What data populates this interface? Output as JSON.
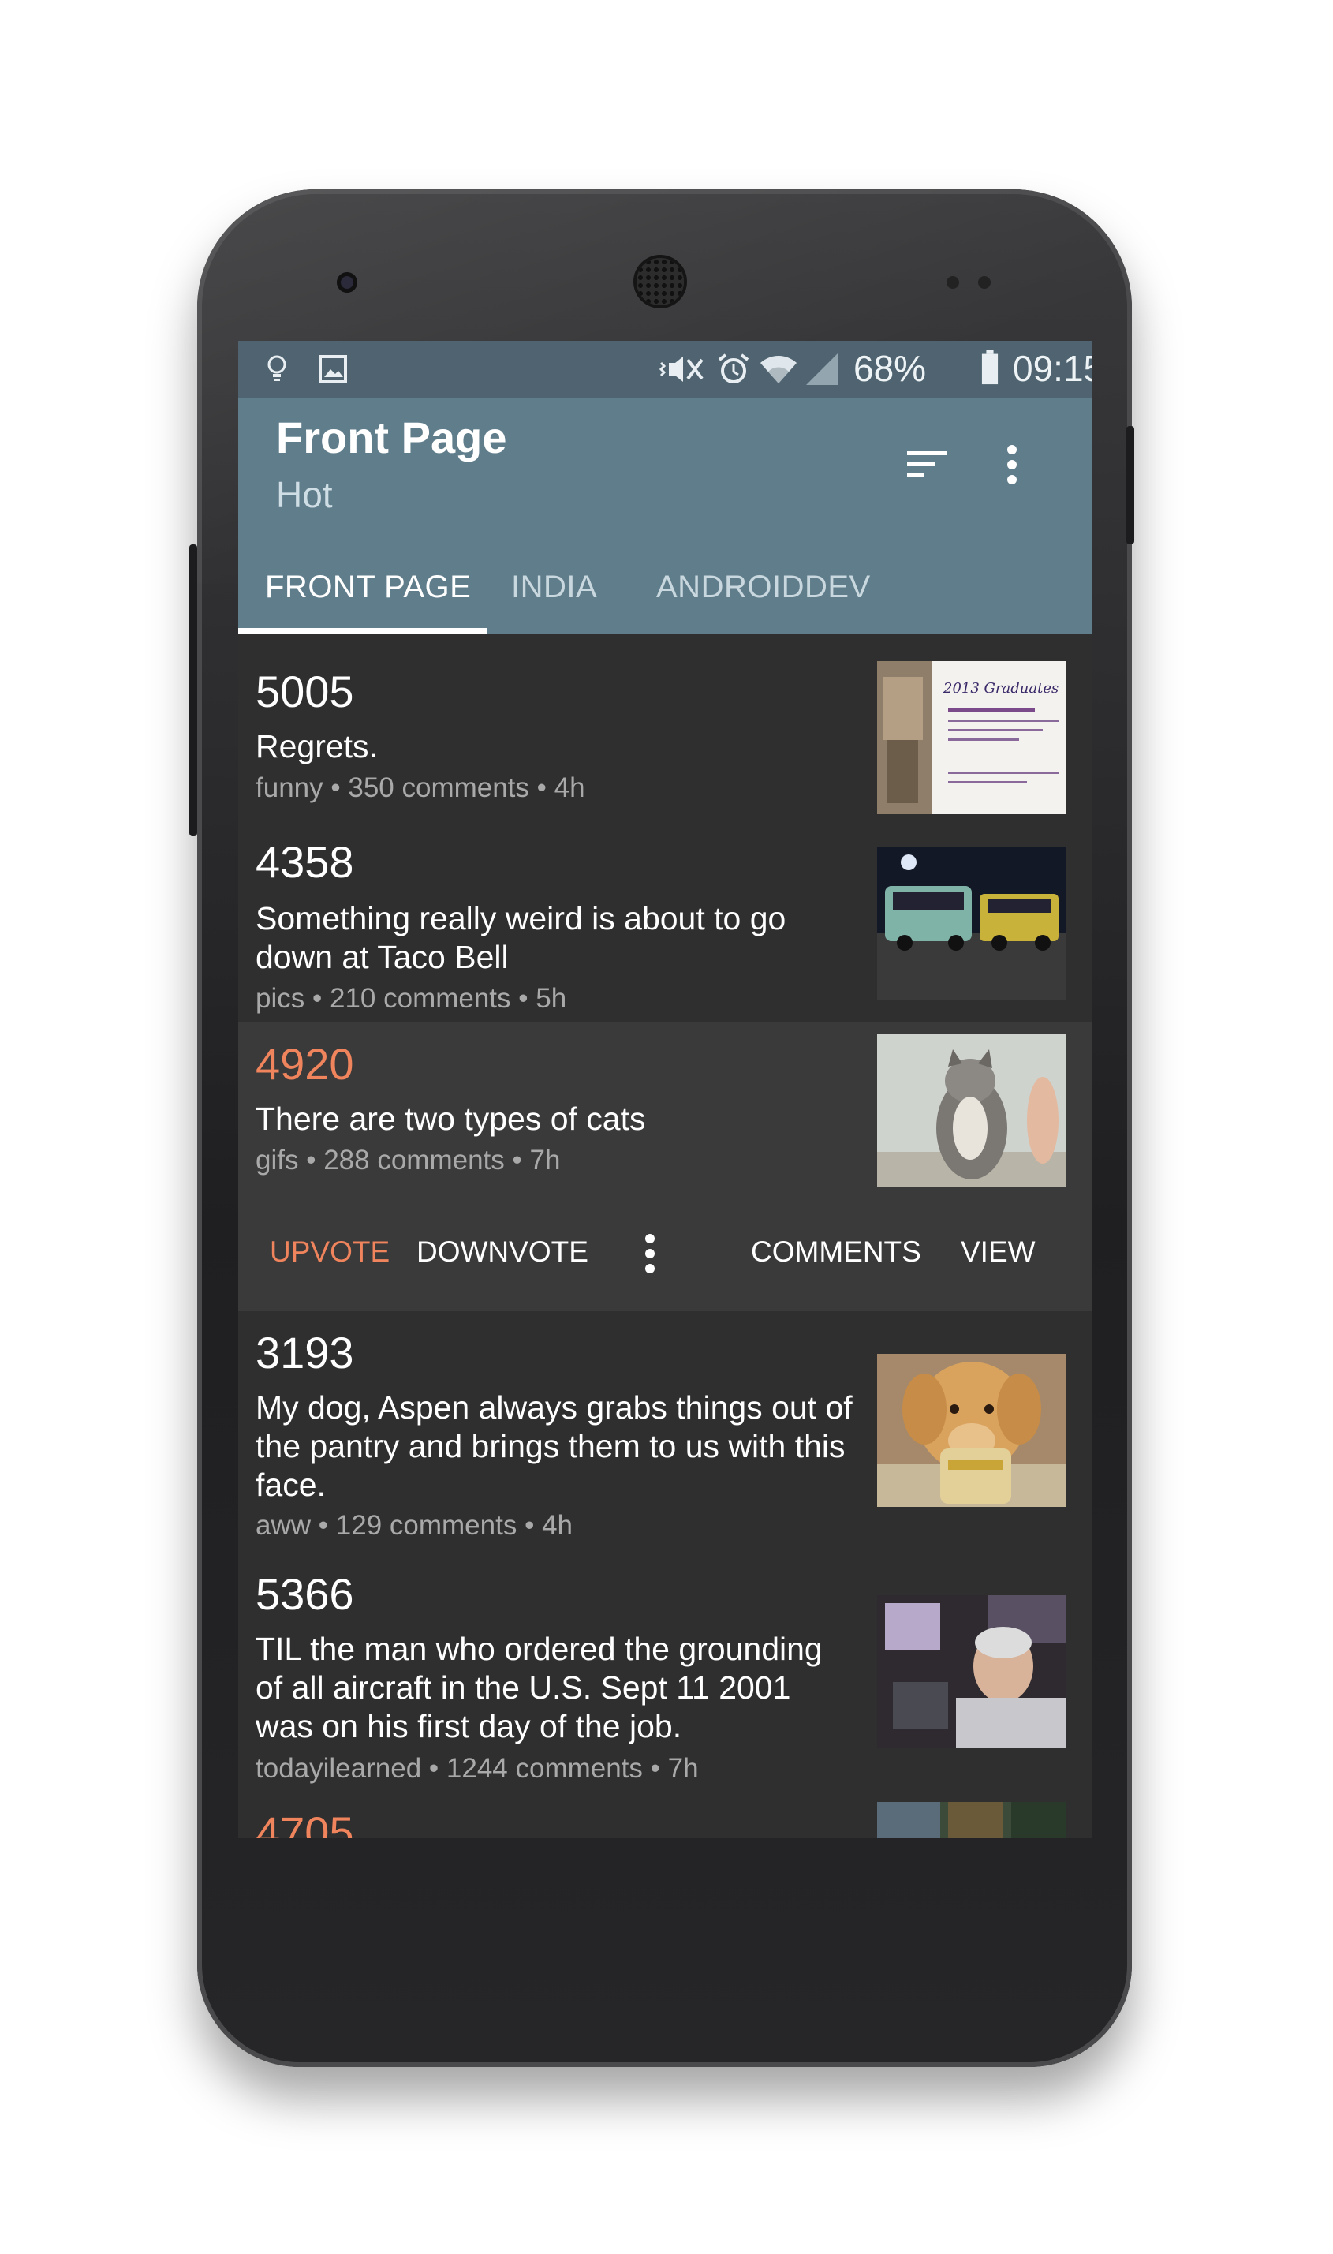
{
  "statusbar": {
    "icons_left": [
      "lightbulb-icon",
      "image-icon"
    ],
    "icons_right": [
      "vibrate-icon",
      "alarm-icon",
      "wifi-icon",
      "signal-icon",
      "battery-icon"
    ],
    "battery": "68%",
    "time": "09:15"
  },
  "appbar": {
    "title": "Front Page",
    "subtitle": "Hot",
    "actions": [
      "sort-icon",
      "more-vert-icon"
    ],
    "tabs": [
      {
        "label": "FRONT PAGE",
        "active": true
      },
      {
        "label": "INDIA",
        "active": false
      },
      {
        "label": "ANDROIDDEV",
        "active": false
      }
    ]
  },
  "posts": [
    {
      "score": "5005",
      "title": "Regrets.",
      "subreddit": "funny",
      "comments": "350 comments",
      "age": "4h",
      "thumb": "graduation-yearbook-thumb",
      "upvoted": false
    },
    {
      "score": "4358",
      "title": "Something really weird is about to go down at Taco Bell",
      "subreddit": "pics",
      "comments": "210 comments",
      "age": "5h",
      "thumb": "mystery-van-thumb",
      "upvoted": false
    },
    {
      "score": "4920",
      "title": "There are two types of cats",
      "subreddit": "gifs",
      "comments": "288 comments",
      "age": "7h",
      "thumb": "cat-high-five-thumb",
      "upvoted": true
    },
    {
      "score": "3193",
      "title": "My dog, Aspen always grabs things out of the pantry and brings them to us with this face.",
      "subreddit": "aww",
      "comments": "129 comments",
      "age": "4h",
      "thumb": "golden-retriever-thumb",
      "upvoted": false
    },
    {
      "score": "5366",
      "title": "TIL the man who ordered the grounding of all aircraft in the U.S. Sept 11 2001 was on his first day of the job.",
      "subreddit": "todayilearned",
      "comments": "1244 comments",
      "age": "7h",
      "thumb": "man-at-desk-thumb",
      "upvoted": false
    },
    {
      "score": "4705",
      "title": "",
      "subreddit": "",
      "comments": "",
      "age": "",
      "thumb": "partial-thumb",
      "upvoted": true
    }
  ],
  "post_actions": {
    "upvote": "UPVOTE",
    "downvote": "DOWNVOTE",
    "more": "more-vert-icon",
    "comments": "COMMENTS",
    "view": "VIEW"
  },
  "separator": "•",
  "colors": {
    "statusbar": "#4f6470",
    "appbar": "#607d8b",
    "background": "#2f2f30",
    "expanded": "#3a3a3b",
    "accent_upvote": "#f0845c",
    "meta_text": "#a9a9aa"
  }
}
